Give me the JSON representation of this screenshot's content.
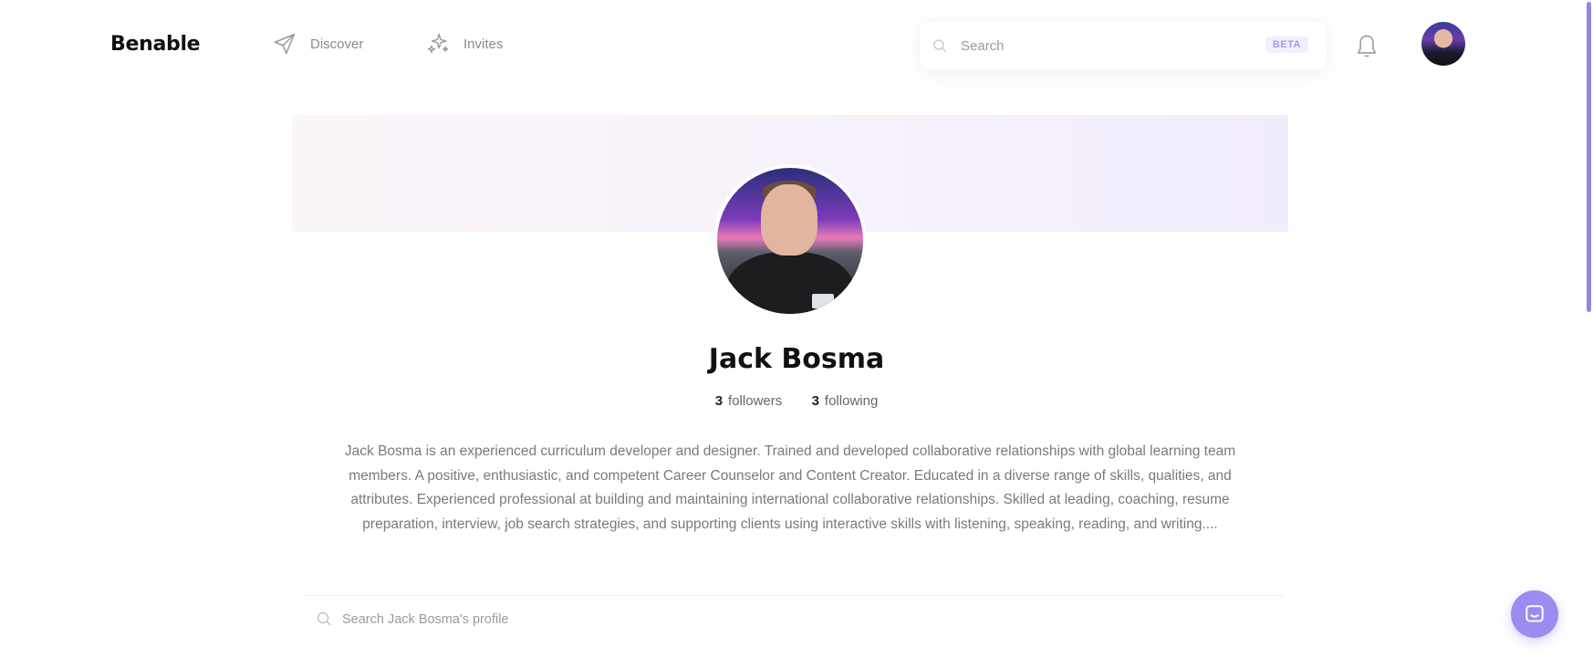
{
  "header": {
    "logo": "Benable",
    "nav": [
      {
        "label": "Discover",
        "icon": "send-icon"
      },
      {
        "label": "Invites",
        "icon": "sparkles-icon"
      }
    ],
    "search": {
      "placeholder": "Search",
      "badge": "BETA"
    },
    "notification_icon": "bell-icon",
    "avatar_icon": "user-avatar"
  },
  "profile": {
    "name": "Jack Bosma",
    "followers_count": "3",
    "followers_label": "followers",
    "following_count": "3",
    "following_label": "following",
    "bio_lines": [
      "Jack Bosma is an experienced curriculum developer and designer. Trained and developed collaborative relationships with global learning team",
      "members. A positive, enthusiastic, and competent Career Counselor and Content Creator. Educated in a diverse range of skills, qualities, and",
      "attributes. Experienced professional at building and maintaining international collaborative relationships. Skilled at leading, coaching, resume",
      "preparation, interview, job search strategies, and supporting clients using interactive skills with listening, speaking, reading, and writing...."
    ],
    "search_placeholder": "Search Jack Bosma's profile"
  },
  "colors": {
    "accent": "#9c8cf0",
    "beta_bg": "#f2effd",
    "beta_text": "#a79be6"
  }
}
